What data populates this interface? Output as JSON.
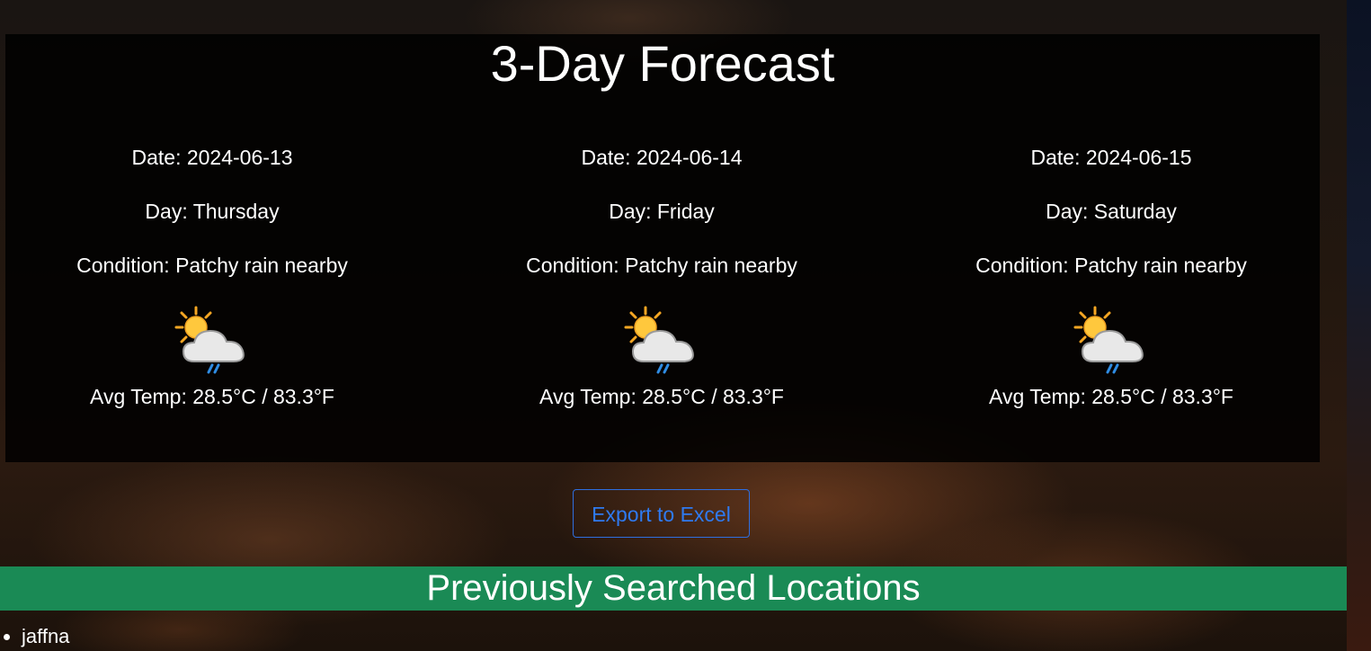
{
  "forecast": {
    "title": "3-Day Forecast",
    "days": [
      {
        "date": "Date: 2024-06-13",
        "day": "Day: Thursday",
        "condition": "Condition: Patchy rain nearby",
        "icon": "patchy-rain-icon",
        "avg_temp": "Avg Temp: 28.5°C / 83.3°F"
      },
      {
        "date": "Date: 2024-06-14",
        "day": "Day: Friday",
        "condition": "Condition: Patchy rain nearby",
        "icon": "patchy-rain-icon",
        "avg_temp": "Avg Temp: 28.5°C / 83.3°F"
      },
      {
        "date": "Date: 2024-06-15",
        "day": "Day: Saturday",
        "condition": "Condition: Patchy rain nearby",
        "icon": "patchy-rain-icon",
        "avg_temp": "Avg Temp: 28.5°C / 83.3°F"
      }
    ]
  },
  "export": {
    "label": "Export to Excel"
  },
  "history": {
    "title": "Previously Searched Locations",
    "items": [
      "jaffna"
    ]
  },
  "colors": {
    "panel_bg": "#000000",
    "accent_green": "#1a8a55",
    "button_blue": "#2f7af0",
    "text": "#ffffff"
  }
}
